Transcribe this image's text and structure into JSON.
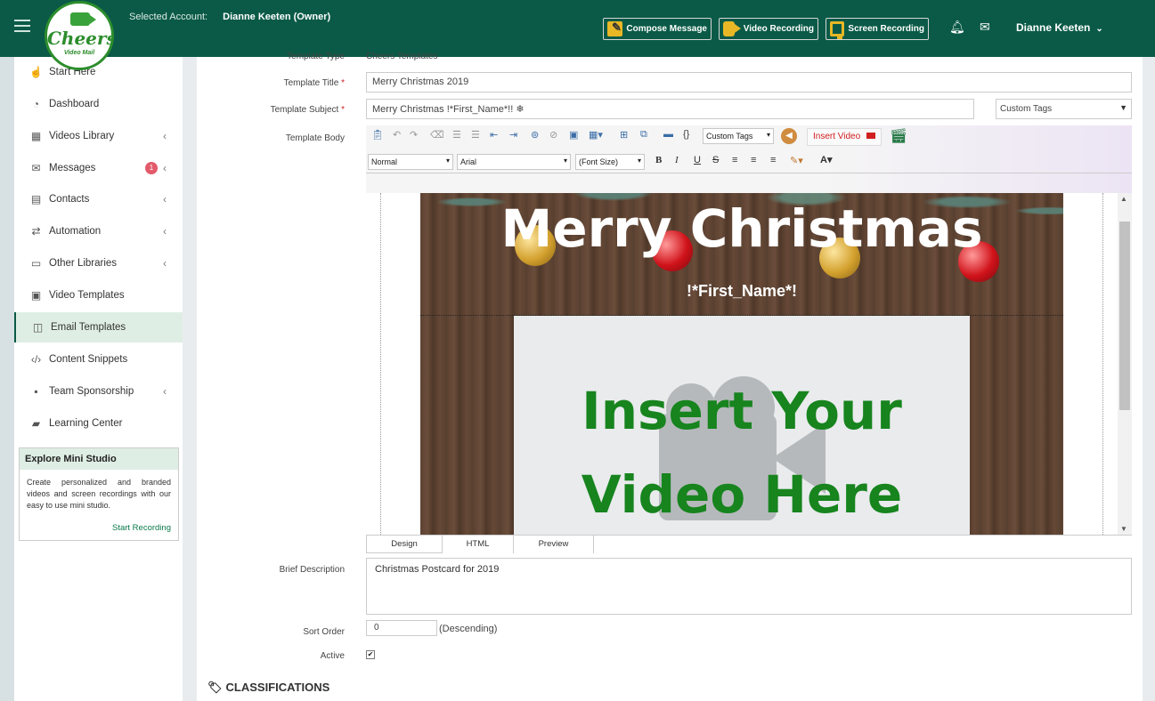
{
  "header": {
    "logo_text": "Cheers!",
    "logo_sub": "Video Mail",
    "selected_account_label": "Selected Account:",
    "selected_account_value": "Dianne Keeten (Owner)",
    "compose_label": "Compose Message",
    "video_recording_label": "Video Recording",
    "screen_recording_label": "Screen Recording",
    "user_name": "Dianne Keeten"
  },
  "sidebar": {
    "items": [
      {
        "label": "Start Here",
        "icon": "pointer-icon"
      },
      {
        "label": "Dashboard",
        "icon": "dashboard-icon"
      },
      {
        "label": "Videos Library",
        "icon": "film-icon"
      },
      {
        "label": "Messages",
        "icon": "envelope-icon",
        "badge": "1"
      },
      {
        "label": "Contacts",
        "icon": "contact-card-icon"
      },
      {
        "label": "Automation",
        "icon": "exchange-icon"
      },
      {
        "label": "Other Libraries",
        "icon": "folder-icon"
      },
      {
        "label": "Video Templates",
        "icon": "image-icon"
      },
      {
        "label": "Email Templates",
        "icon": "columns-icon"
      },
      {
        "label": "Content Snippets",
        "icon": "code-icon"
      },
      {
        "label": "Team Sponsorship",
        "icon": "gift-icon"
      },
      {
        "label": "Learning Center",
        "icon": "book-icon"
      }
    ],
    "mini_studio": {
      "title": "Explore Mini Studio",
      "body": "Create personalized and branded videos and screen recordings with our easy to use mini studio.",
      "link": "Start Recording"
    }
  },
  "form": {
    "template_type_label": "Template Type",
    "template_type_value": "Cheers Templates",
    "title_label": "Template Title",
    "title_value": "Merry Christmas 2019",
    "subject_label": "Template Subject",
    "subject_value": "Merry Christmas !*First_Name*!! ❄",
    "custom_tags_select": "Custom Tags",
    "body_label": "Template Body",
    "description_label": "Brief Description",
    "description_value": "Christmas Postcard for 2019",
    "sort_order_label": "Sort Order",
    "sort_order_value": "0",
    "sort_order_hint": "(Descending)",
    "active_label": "Active",
    "classifications_heading": "CLASSIFICATIONS"
  },
  "editor": {
    "custom_tags": "Custom Tags",
    "insert_video": "Insert Video",
    "format_select": "Normal",
    "font_select": "Arial",
    "size_select": "(Font Size)",
    "tabs": [
      "Design",
      "HTML",
      "Preview"
    ],
    "postcard_title": "Merry Christmas",
    "postcard_name": "!*First_Name*!",
    "video_line1": "Insert Your",
    "video_line2": "Video Here"
  }
}
